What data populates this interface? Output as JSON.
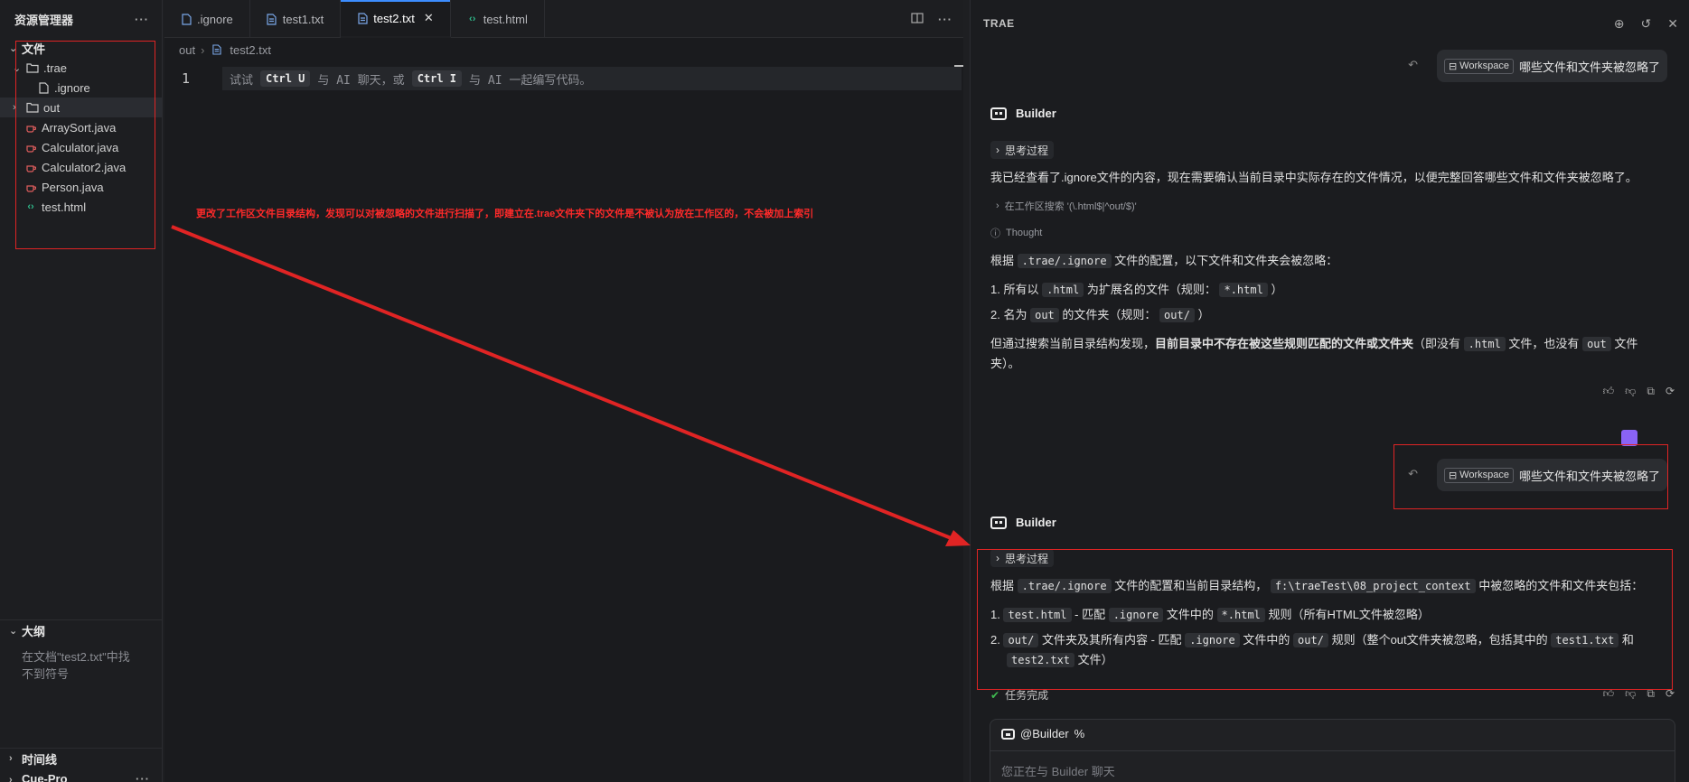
{
  "sidebar": {
    "title": "资源管理器",
    "more": "···",
    "files_section": "文件",
    "tree": [
      {
        "label": ".trae",
        "type": "folder-open"
      },
      {
        "label": ".ignore",
        "type": "file"
      },
      {
        "label": "out",
        "type": "folder"
      },
      {
        "label": "ArraySort.java",
        "type": "java"
      },
      {
        "label": "Calculator.java",
        "type": "java"
      },
      {
        "label": "Calculator2.java",
        "type": "java"
      },
      {
        "label": "Person.java",
        "type": "java"
      },
      {
        "label": "test.html",
        "type": "html"
      }
    ],
    "outline_section": "大纲",
    "outline_text": "在文档\"test2.txt\"中找不到符号",
    "timeline_section": "时间线",
    "cue_section": "Cue-Pro"
  },
  "editor": {
    "tabs": [
      {
        "label": ".ignore"
      },
      {
        "label": "test1.txt"
      },
      {
        "label": "test2.txt",
        "active": true
      },
      {
        "label": "test.html"
      }
    ],
    "breadcrumb": {
      "folder": "out",
      "file": "test2.txt"
    },
    "line_number": "1",
    "hint": {
      "pre": "试试",
      "k1": "Ctrl U",
      "mid": "与 AI 聊天，或",
      "k2": "Ctrl I",
      "post": "与 AI 一起编写代码。"
    },
    "annotation": "更改了工作区文件目录结构，发现可以对被忽略的文件进行扫描了，即建立在.trae文件夹下的文件是不被认为放在工作区的，不会被加上索引"
  },
  "ai_panel": {
    "title": "TRAE",
    "workspace_chip": "Workspace",
    "question": "哪些文件和文件夹被忽略了",
    "builder_label": "Builder",
    "thinking_label": "思考过程",
    "reply1": {
      "intro": "我已经查看了.ignore文件的内容，现在需要确认当前目录中实际存在的文件情况，以便完整回答哪些文件和文件夹被忽略了。",
      "search": "在工作区搜索 '(\\.html$|^out/$)'",
      "thought": "Thought",
      "rule_intro_pre": "根据",
      "rule_intro_code": ".trae/.ignore",
      "rule_intro_post": "文件的配置，以下文件和文件夹会被忽略：",
      "item1_pre": "1. 所有以",
      "item1_code": ".html",
      "item1_mid": "为扩展名的文件（规则：",
      "item1_code2": "*.html",
      "item1_post": "）",
      "item2_pre": "2. 名为",
      "item2_code": "out",
      "item2_mid": "的文件夹（规则：",
      "item2_code2": "out/",
      "item2_post": "）",
      "summary_pre": "但通过搜索当前目录结构发现，",
      "summary_bold": "目前目录中不存在被这些规则匹配的文件或文件夹",
      "summary_mid": "（即没有",
      "summary_code1": ".html",
      "summary_mid2": "文件，也没有",
      "summary_code2": "out",
      "summary_post": "文件",
      "summary_end": "夹）。"
    },
    "reply2": {
      "intro_pre": "根据",
      "intro_code": ".trae/.ignore",
      "intro_mid": "文件的配置和当前目录结构，",
      "intro_code2": "f:\\traeTest\\08_project_context",
      "intro_post": "中被忽略的文件和文件夹包括：",
      "item1_num": "1.",
      "item1_code": "test.html",
      "item1_mid": "- 匹配",
      "item1_code2": ".ignore",
      "item1_mid2": "文件中的",
      "item1_code3": "*.html",
      "item1_post": "规则（所有HTML文件被忽略）",
      "item2_num": "2.",
      "item2_code": "out/",
      "item2_mid": "文件夹及其所有内容 - 匹配",
      "item2_code2": ".ignore",
      "item2_mid2": "文件中的",
      "item2_code3": "out/",
      "item2_post": "规则（整个out文件夹被忽略，包括其中的",
      "item2_code4": "test1.txt",
      "item2_and": "和",
      "item2_code5": "test2.txt",
      "item2_end": "文件）"
    },
    "task_done": "任务完成",
    "chat_tag": "@Builder",
    "chat_tag_icon": "%",
    "chat_placeholder": "您正在与 Builder 聊天"
  },
  "colors": {
    "annotation": "#e02424",
    "accent": "#3c8dff",
    "java": "#e05d5d",
    "html": "#2fb98a",
    "done": "#3fb950",
    "avatar": "#8a63f5"
  }
}
